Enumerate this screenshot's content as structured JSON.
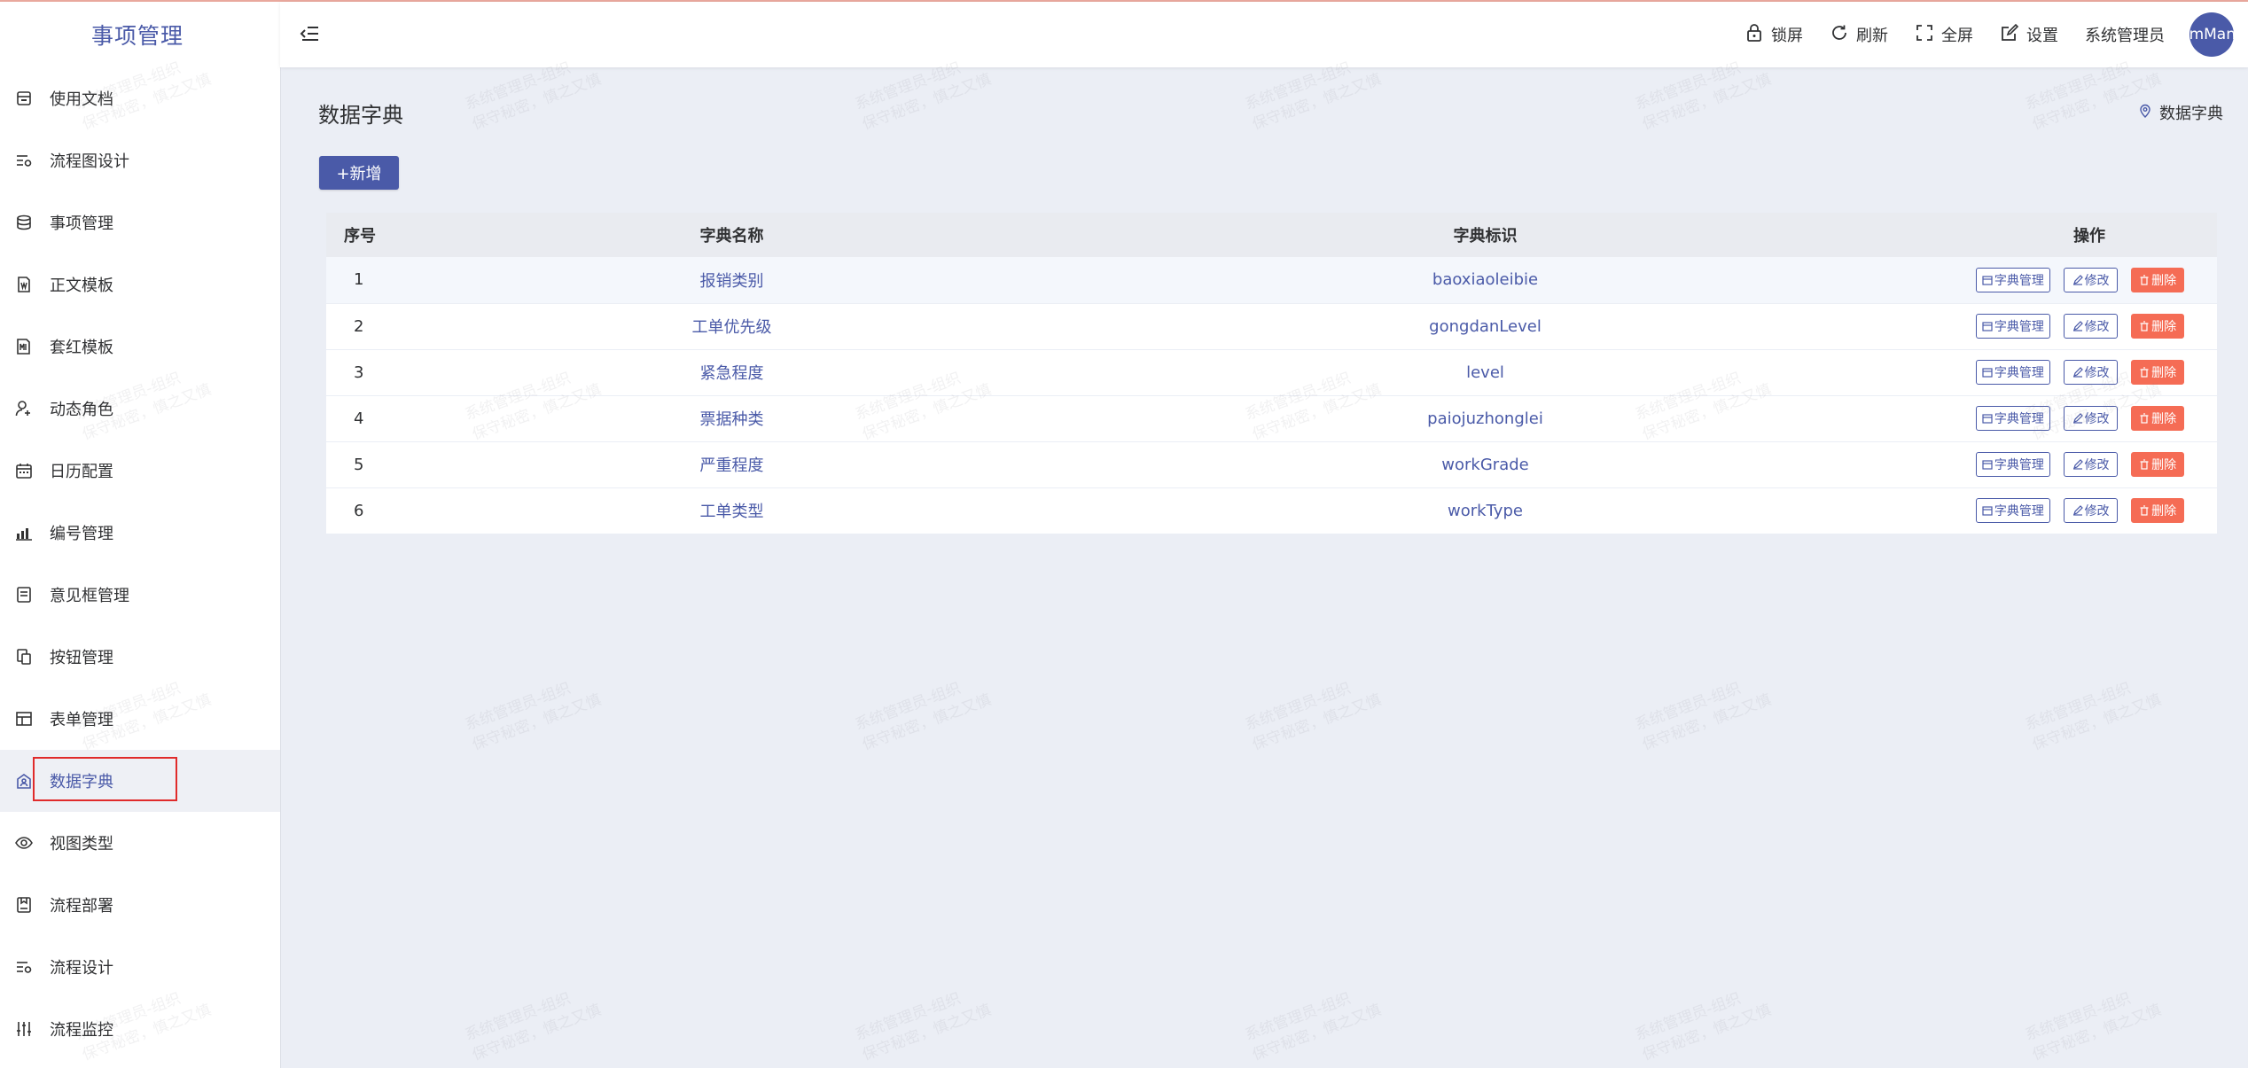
{
  "app": {
    "title": "事项管理"
  },
  "sidebar": {
    "items": [
      {
        "label": "使用文档",
        "icon": "document-icon"
      },
      {
        "label": "流程图设计",
        "icon": "flow-settings-icon"
      },
      {
        "label": "事项管理",
        "icon": "database-icon"
      },
      {
        "label": "正文模板",
        "icon": "word-template-icon"
      },
      {
        "label": "套红模板",
        "icon": "red-template-icon"
      },
      {
        "label": "动态角色",
        "icon": "user-add-icon"
      },
      {
        "label": "日历配置",
        "icon": "calendar-icon"
      },
      {
        "label": "编号管理",
        "icon": "bar-chart-icon"
      },
      {
        "label": "意见框管理",
        "icon": "form-box-icon"
      },
      {
        "label": "按钮管理",
        "icon": "copy-icon"
      },
      {
        "label": "表单管理",
        "icon": "table-icon"
      },
      {
        "label": "数据字典",
        "icon": "dictionary-icon",
        "active": true
      },
      {
        "label": "视图类型",
        "icon": "eye-icon"
      },
      {
        "label": "流程部署",
        "icon": "deploy-icon"
      },
      {
        "label": "流程设计",
        "icon": "flow-design-icon"
      },
      {
        "label": "流程监控",
        "icon": "sliders-icon"
      }
    ]
  },
  "header": {
    "lock_label": "锁屏",
    "refresh_label": "刷新",
    "fullscreen_label": "全屏",
    "settings_label": "设置",
    "username": "系统管理员",
    "avatar_text": "emMan"
  },
  "page": {
    "title": "数据字典",
    "breadcrumb": "数据字典",
    "add_label": "+新增"
  },
  "table": {
    "columns": [
      "序号",
      "字典名称",
      "字典标识",
      "操作"
    ],
    "actions": {
      "dict": "字典管理",
      "edit": "修改",
      "delete": "删除"
    },
    "rows": [
      {
        "idx": "1",
        "name": "报销类别",
        "code": "baoxiaoleibie"
      },
      {
        "idx": "2",
        "name": "工单优先级",
        "code": "gongdanLevel"
      },
      {
        "idx": "3",
        "name": "紧急程度",
        "code": "level"
      },
      {
        "idx": "4",
        "name": "票据种类",
        "code": "paiojuzhonglei"
      },
      {
        "idx": "5",
        "name": "严重程度",
        "code": "workGrade"
      },
      {
        "idx": "6",
        "name": "工单类型",
        "code": "workType"
      }
    ]
  },
  "watermark": {
    "line1": "系统管理员-组织",
    "line2": "保守秘密，慎之又慎"
  },
  "colors": {
    "accent": "#4a5aa8",
    "danger": "#f56c55",
    "highlight_border": "#e02b2b"
  }
}
